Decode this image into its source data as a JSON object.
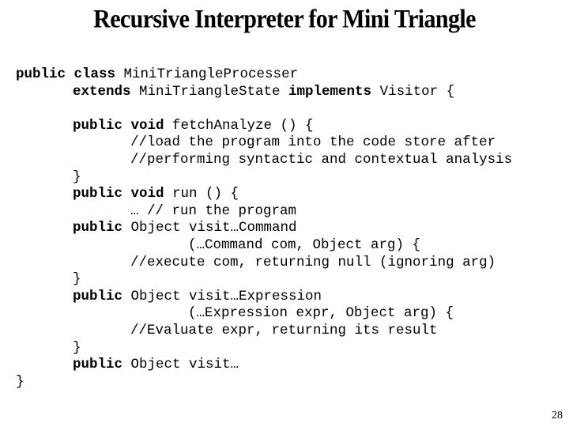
{
  "slide": {
    "title": "Recursive Interpreter for Mini Triangle",
    "page_number": "28"
  },
  "code": {
    "lines": [
      {
        "indent": 0,
        "row": 0,
        "parts": [
          {
            "t": "public class ",
            "b": true
          },
          {
            "t": "MiniTriangleProcesser",
            "b": false
          }
        ]
      },
      {
        "indent": 1,
        "row": 1,
        "parts": [
          {
            "t": "extends ",
            "b": true
          },
          {
            "t": "MiniTriangleState ",
            "b": false
          },
          {
            "t": "implements ",
            "b": true
          },
          {
            "t": "Visitor {",
            "b": false
          }
        ]
      },
      {
        "indent": 1,
        "row": 3,
        "parts": [
          {
            "t": "public void ",
            "b": true
          },
          {
            "t": "fetchAnalyze () {",
            "b": false
          }
        ]
      },
      {
        "indent": 2,
        "row": 4,
        "parts": [
          {
            "t": "//load the program into the code store after",
            "b": false
          }
        ]
      },
      {
        "indent": 2,
        "row": 5,
        "parts": [
          {
            "t": "//performing syntactic and contextual analysis",
            "b": false
          }
        ]
      },
      {
        "indent": 1,
        "row": 6,
        "parts": [
          {
            "t": "}",
            "b": false
          }
        ]
      },
      {
        "indent": 1,
        "row": 7,
        "parts": [
          {
            "t": "public void ",
            "b": true
          },
          {
            "t": "run () {",
            "b": false
          }
        ]
      },
      {
        "indent": 2,
        "row": 8,
        "parts": [
          {
            "t": "… // run the program",
            "b": false
          }
        ]
      },
      {
        "indent": 1,
        "row": 9,
        "parts": [
          {
            "t": "public ",
            "b": true
          },
          {
            "t": "Object visit…Command",
            "b": false
          }
        ]
      },
      {
        "indent": 3,
        "row": 10,
        "parts": [
          {
            "t": "(…Command com, Object arg) {",
            "b": false
          }
        ]
      },
      {
        "indent": 2,
        "row": 11,
        "parts": [
          {
            "t": "//execute com, returning null (ignoring arg)",
            "b": false
          }
        ]
      },
      {
        "indent": 1,
        "row": 12,
        "parts": [
          {
            "t": "}",
            "b": false
          }
        ]
      },
      {
        "indent": 1,
        "row": 13,
        "parts": [
          {
            "t": "public ",
            "b": true
          },
          {
            "t": "Object visit…Expression",
            "b": false
          }
        ]
      },
      {
        "indent": 3,
        "row": 14,
        "parts": [
          {
            "t": "(…Expression expr, Object arg) {",
            "b": false
          }
        ]
      },
      {
        "indent": 2,
        "row": 15,
        "parts": [
          {
            "t": "//Evaluate expr, returning its result",
            "b": false
          }
        ]
      },
      {
        "indent": 1,
        "row": 16,
        "parts": [
          {
            "t": "}",
            "b": false
          }
        ]
      },
      {
        "indent": 1,
        "row": 17,
        "parts": [
          {
            "t": "public ",
            "b": true
          },
          {
            "t": "Object visit…",
            "b": false
          }
        ]
      },
      {
        "indent": 0,
        "row": 18,
        "parts": [
          {
            "t": "}",
            "b": false
          }
        ]
      }
    ]
  }
}
